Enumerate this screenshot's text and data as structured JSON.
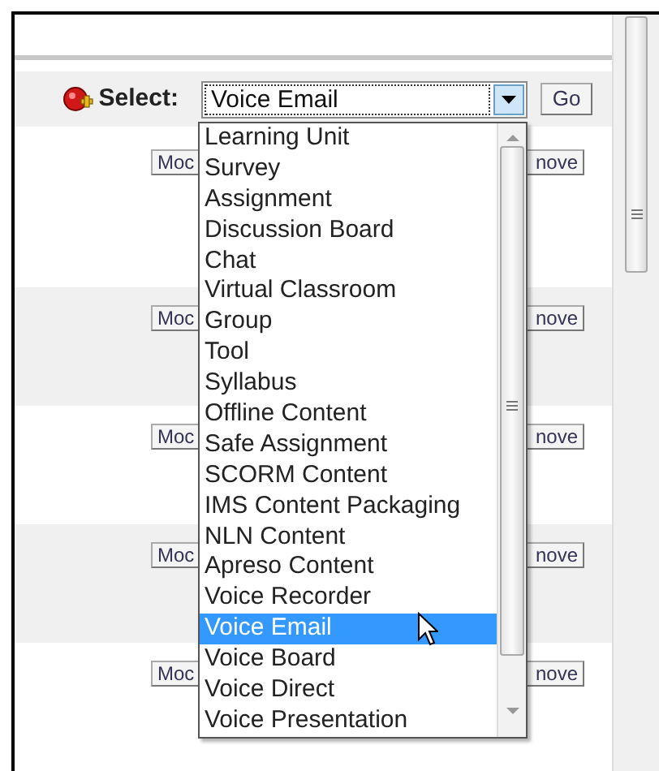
{
  "toolbar": {
    "label": "Select:",
    "value": "Voice Email",
    "go": "Go"
  },
  "rows": [
    {
      "left": "Moc",
      "right": "nove"
    },
    {
      "left": "Moc",
      "right": "nove"
    },
    {
      "left": "Moc",
      "right": "nove"
    },
    {
      "left": "Moc",
      "right": "nove"
    },
    {
      "left": "Moc",
      "right": "nove"
    }
  ],
  "dropdown": {
    "options": [
      {
        "label": "Learning Unit",
        "selected": false
      },
      {
        "label": "Survey",
        "selected": false
      },
      {
        "label": "Assignment",
        "selected": false
      },
      {
        "label": "Discussion Board",
        "selected": false
      },
      {
        "label": "Chat",
        "selected": false
      },
      {
        "label": "Virtual Classroom",
        "selected": false
      },
      {
        "label": "Group",
        "selected": false
      },
      {
        "label": "Tool",
        "selected": false
      },
      {
        "label": "Syllabus",
        "selected": false
      },
      {
        "label": "Offline Content",
        "selected": false
      },
      {
        "label": "Safe Assignment",
        "selected": false
      },
      {
        "label": "SCORM Content",
        "selected": false
      },
      {
        "label": "IMS Content Packaging",
        "selected": false
      },
      {
        "label": "NLN Content",
        "selected": false
      },
      {
        "label": "Apreso Content",
        "selected": false
      },
      {
        "label": "Voice Recorder",
        "selected": false
      },
      {
        "label": "Voice Email",
        "selected": true
      },
      {
        "label": "Voice Board",
        "selected": false
      },
      {
        "label": "Voice Direct",
        "selected": false
      },
      {
        "label": "Voice Presentation",
        "selected": false
      }
    ]
  }
}
